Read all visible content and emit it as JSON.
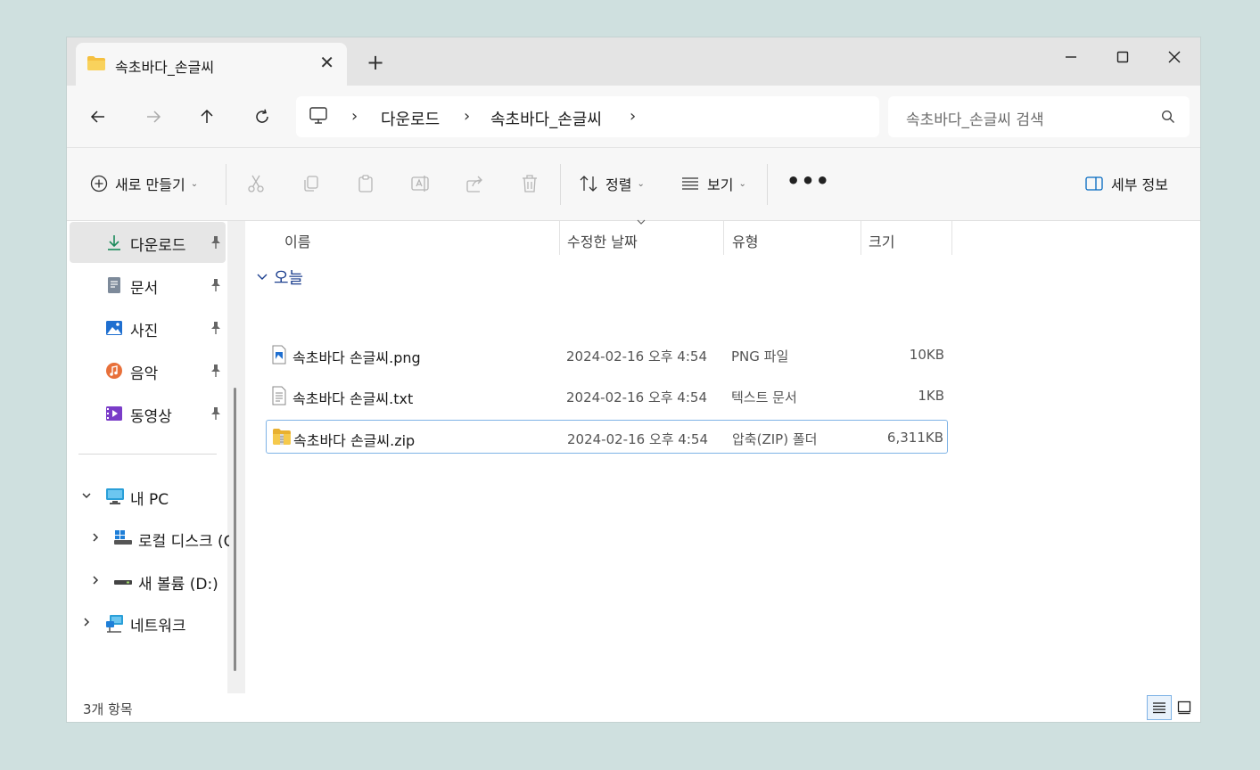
{
  "window": {
    "tab_title": "속초바다_손글씨",
    "new_tab": "+",
    "close_tab": "✕"
  },
  "address": {
    "breadcrumb": [
      "다운로드",
      "속초바다_손글씨"
    ],
    "separator": "›",
    "search_placeholder": "속초바다_손글씨 검색"
  },
  "commands": {
    "new_label": "새로 만들기",
    "sort_label": "정렬",
    "view_label": "보기",
    "more_label": "•••",
    "details_label": "세부 정보"
  },
  "sidebar": {
    "quick_access": [
      {
        "label": "다운로드",
        "icon": "download-icon",
        "pinned": true,
        "active": true
      },
      {
        "label": "문서",
        "icon": "document-icon",
        "pinned": true,
        "active": false
      },
      {
        "label": "사진",
        "icon": "picture-icon",
        "pinned": true,
        "active": false
      },
      {
        "label": "음악",
        "icon": "music-icon",
        "pinned": true,
        "active": false
      },
      {
        "label": "동영상",
        "icon": "video-icon",
        "pinned": true,
        "active": false
      }
    ],
    "this_pc_label": "내 PC",
    "local_disk_label": "로컬 디스크 (C:)",
    "new_volume_label": "새 볼륨 (D:)",
    "network_label": "네트워크"
  },
  "columns": {
    "name": "이름",
    "date": "수정한 날짜",
    "type": "유형",
    "size": "크기"
  },
  "group_label": "오늘",
  "files": [
    {
      "name": "속초바다 손글씨.png",
      "date": "2024-02-16 오후 4:54",
      "type": "PNG 파일",
      "size": "10KB",
      "icon": "png-file-icon"
    },
    {
      "name": "속초바다 손글씨.txt",
      "date": "2024-02-16 오후 4:54",
      "type": "텍스트 문서",
      "size": "1KB",
      "icon": "text-file-icon"
    },
    {
      "name": "속초바다 손글씨.zip",
      "date": "2024-02-16 오후 4:54",
      "type": "압축(ZIP) 폴더",
      "size": "6,311KB",
      "icon": "zip-folder-icon"
    }
  ],
  "status": {
    "item_count": "3개 항목"
  },
  "colors": {
    "accent": "#0067c0",
    "folder": "#f5c040",
    "selection_border": "#7fb3e6",
    "group_text": "#1c3f8f"
  }
}
